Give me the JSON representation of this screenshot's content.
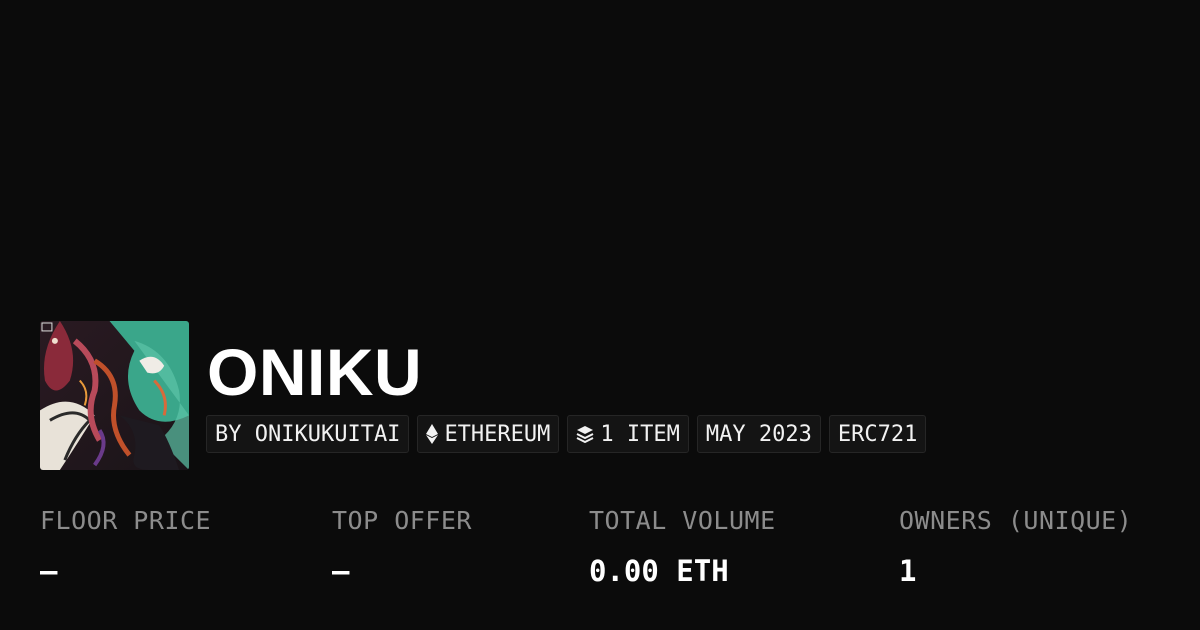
{
  "collection": {
    "title": "ONIKU",
    "avatar_icon": "collection-artwork"
  },
  "badges": {
    "creator": "BY ONIKUKUITAI",
    "chain": "ETHEREUM",
    "chain_icon": "ethereum-icon",
    "items": "1 ITEM",
    "items_icon": "layers-icon",
    "date": "MAY 2023",
    "standard": "ERC721"
  },
  "stats": {
    "floor_price": {
      "label": "FLOOR PRICE",
      "value": "–"
    },
    "top_offer": {
      "label": "TOP OFFER",
      "value": "–"
    },
    "total_volume": {
      "label": "TOTAL VOLUME",
      "value": "0.00 ETH"
    },
    "owners": {
      "label": "OWNERS (UNIQUE)",
      "value": "1"
    }
  },
  "colors": {
    "background": "#0b0b0b",
    "label": "#8c8c8c",
    "text": "#ffffff",
    "badge_border": "#262626"
  }
}
